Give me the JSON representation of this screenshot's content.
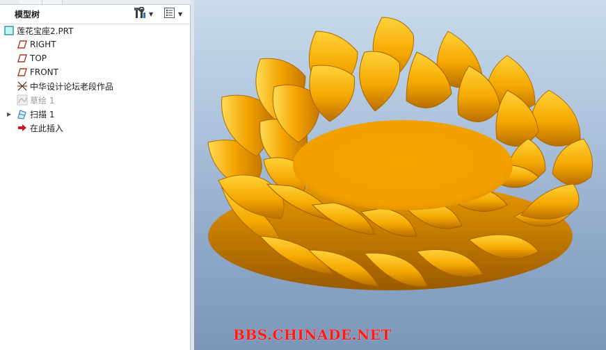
{
  "model_tree": {
    "title": "模型树",
    "items": [
      {
        "label": "莲花宝座2.PRT",
        "icon": "part-icon",
        "state": "normal"
      },
      {
        "label": "RIGHT",
        "icon": "datum-plane-icon",
        "state": "normal"
      },
      {
        "label": "TOP",
        "icon": "datum-plane-icon",
        "state": "normal"
      },
      {
        "label": "FRONT",
        "icon": "datum-plane-icon",
        "state": "normal"
      },
      {
        "label": "中华设计论坛老段作品",
        "icon": "coordinate-system-icon",
        "state": "normal"
      },
      {
        "label": "草绘 1",
        "icon": "sketch-icon",
        "state": "suppressed"
      },
      {
        "label": "扫描 1",
        "icon": "sweep-icon",
        "state": "normal"
      },
      {
        "label": "在此插入",
        "icon": "insert-here-arrow-icon",
        "state": "normal"
      }
    ]
  },
  "viewport": {
    "watermark": "BBS.CHINADE.NET",
    "model_color": "#f5a800",
    "background_color": "#9db6d3"
  }
}
